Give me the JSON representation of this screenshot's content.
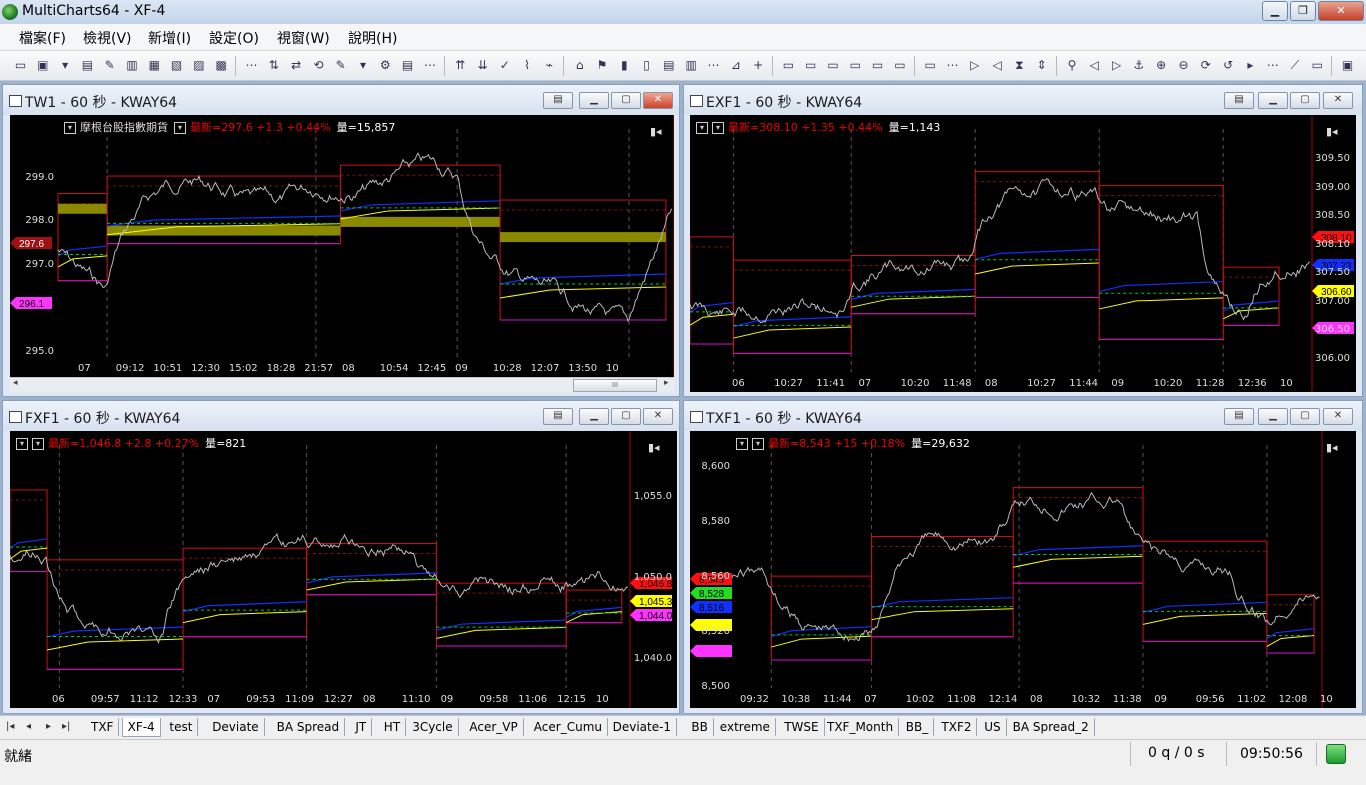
{
  "window": {
    "title": "MultiCharts64 - XF-4"
  },
  "menu": [
    "檔案(F)",
    "檢視(V)",
    "新增(I)",
    "設定(O)",
    "視窗(W)",
    "說明(H)"
  ],
  "colors": {
    "last": "#ff0000",
    "volume": "#ffffff",
    "high_band": "#cc0000",
    "low_band": "#cc00cc",
    "vwap_blue": "#0033ff",
    "yellow": "#ffff00",
    "green": "#00cc33",
    "price": "#c0c0c0",
    "zone": "#8a8a00"
  },
  "charts": [
    {
      "id": "tw1",
      "title": "TW1 - 60 秒 - KWAY64",
      "symbol_name": "摩根台股指數期貨",
      "last": "最新=297.6",
      "change": "+1.3",
      "pct": "+0.44%",
      "volume": "量=15,857",
      "price_ticks": [
        "299.0",
        "298.0",
        "297.0",
        "295.0"
      ],
      "time_ticks": [
        "07",
        "09:12",
        "10:51",
        "12:30",
        "15:02",
        "18:28",
        "21:57",
        "08",
        "10:54",
        "12:45",
        "09",
        "10:28",
        "12:07",
        "13:50",
        "10"
      ],
      "markers": [
        "297.6",
        "296.1"
      ],
      "scroll_thumb": "III"
    },
    {
      "id": "exf1",
      "title": "EXF1 - 60 秒 - KWAY64",
      "last": "最新=308.10",
      "change": "+1.35",
      "pct": "+0.44%",
      "volume": "量=1,143",
      "price_ticks": [
        "309.50",
        "309.00",
        "308.50",
        "308.10",
        "307.50",
        "307.00",
        "306.50",
        "306.00"
      ],
      "time_ticks": [
        "06",
        "10:27",
        "11:41",
        "07",
        "10:20",
        "11:48",
        "08",
        "10:27",
        "11:44",
        "09",
        "10:20",
        "11:28",
        "12:36",
        "10"
      ],
      "markers": [
        "308.10",
        "307.23",
        "306.60"
      ]
    },
    {
      "id": "fxf1",
      "title": "FXF1 - 60 秒 - KWAY64",
      "last": "最新=1,046.8",
      "change": "+2.8",
      "pct": "+0.27%",
      "volume": "量=821",
      "price_ticks": [
        "1,055.0",
        "1,050.0",
        "1,040.0"
      ],
      "time_ticks": [
        "06",
        "09:57",
        "11:12",
        "12:33",
        "07",
        "09:53",
        "11:09",
        "12:27",
        "08",
        "11:10",
        "09",
        "09:58",
        "11:06",
        "12:15",
        "10"
      ],
      "markers": [
        "1,046.8",
        "1,045.3",
        "1,044.0"
      ]
    },
    {
      "id": "txf1",
      "title": "TXF1 - 60 秒 - KWAY64",
      "last": "最新=8,543",
      "change": "+15",
      "pct": "+0.18%",
      "volume": "量=29,632",
      "price_ticks": [
        "8,600",
        "8,580",
        "8,560",
        "8,520",
        "8,500"
      ],
      "time_ticks": [
        "09:32",
        "10:38",
        "11:44",
        "07",
        "10:02",
        "11:08",
        "12:14",
        "08",
        "10:32",
        "11:38",
        "09",
        "09:56",
        "11:02",
        "12:08",
        "10"
      ],
      "markers": [
        "8,543",
        "8,528",
        "8,516"
      ]
    }
  ],
  "sheet_tabs": [
    "TXF",
    "XF-4",
    "test",
    "Deviate",
    "BA Spread",
    "JT",
    "HT",
    "3Cycle",
    "Acer_VP",
    "Acer_Cumu",
    "Deviate-1",
    "BB",
    "extreme",
    "TWSE",
    "TXF_Month",
    "BB_",
    "TXF2",
    "US",
    "BA Spread_2"
  ],
  "active_tab": "XF-4",
  "status": {
    "ready": "就緒",
    "queue": "0 q / 0 s",
    "clock": "09:50:56"
  }
}
